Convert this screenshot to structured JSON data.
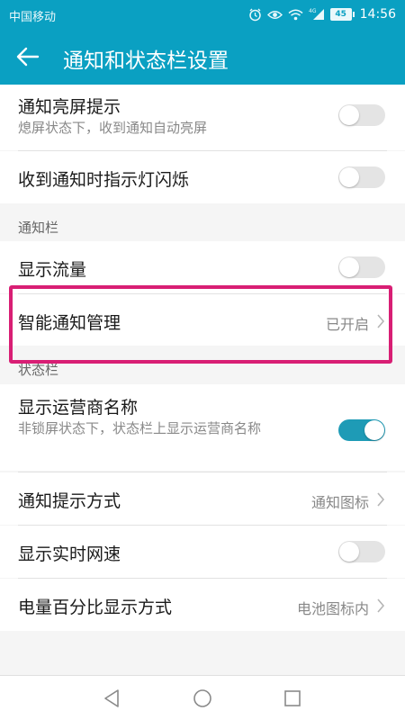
{
  "status_bar": {
    "carrier": "中国移动",
    "network": "4G",
    "battery": "45",
    "time": "14:56"
  },
  "app_bar": {
    "title": "通知和状态栏设置"
  },
  "rows": {
    "lock_screen_wake": {
      "title": "通知亮屏提示",
      "subtitle": "熄屏状态下，收到通知自动亮屏",
      "enabled": false
    },
    "led_blink": {
      "title": "收到通知时指示灯闪烁",
      "enabled": false
    },
    "show_traffic": {
      "title": "显示流量",
      "enabled": false
    },
    "smart_notify": {
      "title": "智能通知管理",
      "value": "已开启"
    },
    "carrier_name": {
      "title": "显示运营商名称",
      "subtitle": "非锁屏状态下，状态栏上显示运营商名称",
      "enabled": true
    },
    "notify_style": {
      "title": "通知提示方式",
      "value": "通知图标"
    },
    "net_speed": {
      "title": "显示实时网速",
      "enabled": false
    },
    "battery_pct": {
      "title": "电量百分比显示方式",
      "value": "电池图标内"
    }
  },
  "sections": {
    "notification_bar": "通知栏",
    "status_bar": "状态栏"
  },
  "colors": {
    "accent": "#0aa0c2",
    "toggle_on": "#1e9bb6",
    "highlight": "#d81e74"
  }
}
